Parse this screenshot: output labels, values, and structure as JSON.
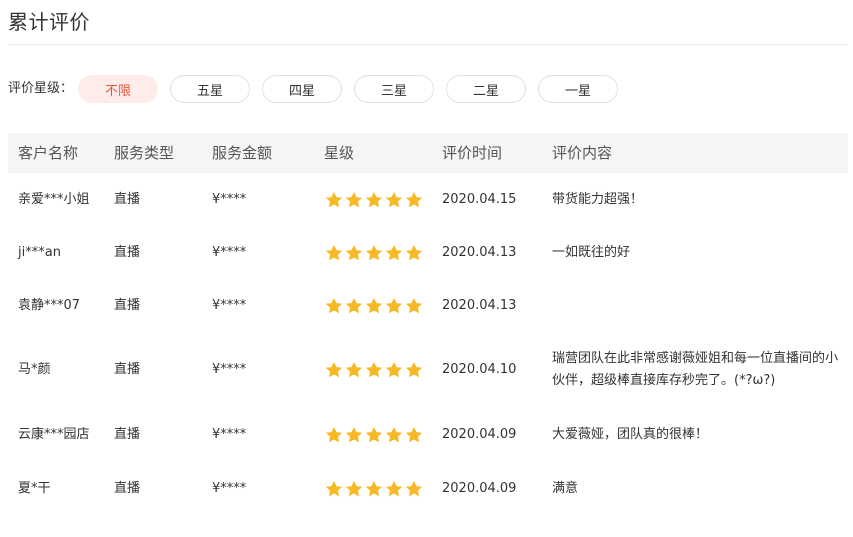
{
  "page": {
    "title": "累计评价"
  },
  "filter": {
    "label": "评价星级：",
    "options": [
      "不限",
      "五星",
      "四星",
      "三星",
      "二星",
      "一星"
    ],
    "selected": "不限"
  },
  "table": {
    "headers": {
      "customer": "客户名称",
      "service_type": "服务类型",
      "amount": "服务金额",
      "rating": "星级",
      "time": "评价时间",
      "content": "评价内容"
    },
    "rows": [
      {
        "customer": "亲爱***小姐",
        "service_type": "直播",
        "amount": "¥****",
        "stars": 5,
        "time": "2020.04.15",
        "content": "带货能力超强！"
      },
      {
        "customer": "ji***an",
        "service_type": "直播",
        "amount": "¥****",
        "stars": 5,
        "time": "2020.04.13",
        "content": "一如既往的好"
      },
      {
        "customer": "袁静***07",
        "service_type": "直播",
        "amount": "¥****",
        "stars": 5,
        "time": "2020.04.13",
        "content": ""
      },
      {
        "customer": "马*颜",
        "service_type": "直播",
        "amount": "¥****",
        "stars": 5,
        "time": "2020.04.10",
        "content": "瑞营团队在此非常感谢薇娅姐和每一位直播间的小伙伴，超级棒直接库存秒完了。(*?ω?)"
      },
      {
        "customer": "云康***园店",
        "service_type": "直播",
        "amount": "¥****",
        "stars": 5,
        "time": "2020.04.09",
        "content": "大爱薇娅，团队真的很棒！"
      },
      {
        "customer": "夏*干",
        "service_type": "直播",
        "amount": "¥****",
        "stars": 5,
        "time": "2020.04.09",
        "content": "满意"
      }
    ]
  },
  "colors": {
    "star": "#f7b925",
    "active_bg": "#fdecea",
    "active_text": "#e8593c",
    "header_bg": "#f5f5f5"
  }
}
